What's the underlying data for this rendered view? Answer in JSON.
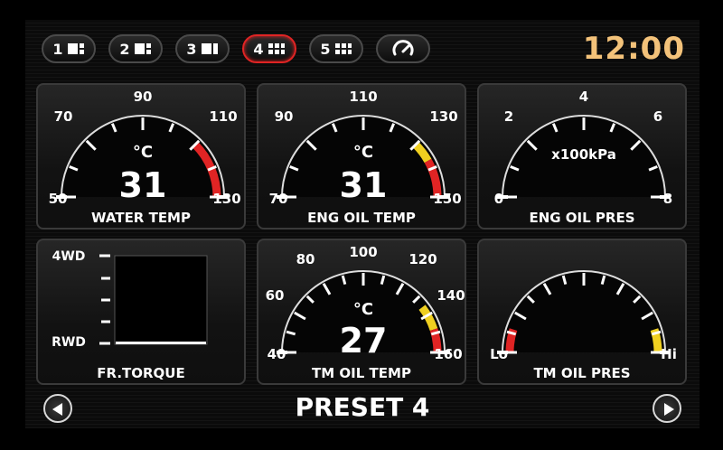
{
  "clock": "12:00",
  "tabs": [
    {
      "label": "1",
      "icon": "layout-1-icon",
      "active": false
    },
    {
      "label": "2",
      "icon": "layout-2-icon",
      "active": false
    },
    {
      "label": "3",
      "icon": "layout-3-icon",
      "active": false
    },
    {
      "label": "4",
      "icon": "layout-4-icon",
      "active": true
    },
    {
      "label": "5",
      "icon": "layout-5-icon",
      "active": false
    },
    {
      "icon": "gauge-icon",
      "active": false
    }
  ],
  "gauges": {
    "water_temp": {
      "title": "WATER TEMP",
      "unit": "°C",
      "value": "31",
      "value_num": 31,
      "ticks": [
        "50",
        "70",
        "90",
        "110",
        "130"
      ],
      "min": 50,
      "max": 130,
      "warn_from": 110,
      "warn_color": "#e02424"
    },
    "eng_oil_temp": {
      "title": "ENG OIL TEMP",
      "unit": "°C",
      "value": "31",
      "value_num": 31,
      "ticks": [
        "70",
        "90",
        "110",
        "130",
        "150"
      ],
      "min": 70,
      "max": 150,
      "yellow_from": 130,
      "red_from": 137
    },
    "eng_oil_pres": {
      "title": "ENG OIL PRES",
      "unit": "x100kPa",
      "ticks": [
        "0",
        "2",
        "4",
        "6",
        "8"
      ],
      "min": 0,
      "max": 8
    },
    "fr_torque": {
      "title": "FR.TORQUE",
      "top_label": "4WD",
      "bottom_label": "RWD",
      "value_fraction": 0
    },
    "tm_oil_temp": {
      "title": "TM OIL TEMP",
      "unit": "°C",
      "value": "27",
      "value_num": 27,
      "ticks": [
        "40",
        "60",
        "80",
        "100",
        "120",
        "140",
        "160"
      ],
      "min": 40,
      "max": 160,
      "yellow_from": 135,
      "red_from": 148
    },
    "tm_oil_pres": {
      "title": "TM OIL PRES",
      "lo_label": "Lo",
      "hi_label": "Hi"
    }
  },
  "preset_label": "PRESET 4",
  "colors": {
    "clock": "#f3c27a",
    "active_tab": "#e02424",
    "warn_red": "#e02424",
    "warn_yellow": "#f0d020"
  }
}
